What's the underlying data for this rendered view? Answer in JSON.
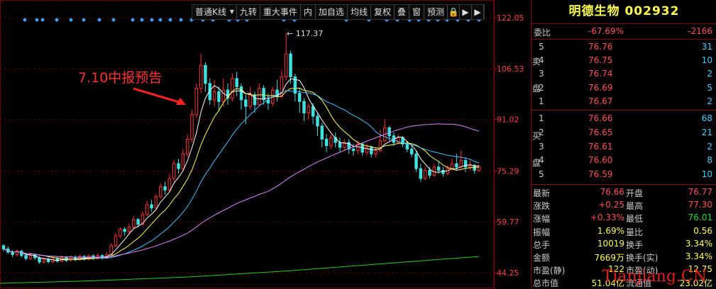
{
  "toolbar": {
    "items": [
      "普通K线",
      "九转",
      "重大事件",
      "内",
      "加自选",
      "均线",
      "复权",
      "叠",
      "窗",
      "预测"
    ],
    "nav_lock": "🔒",
    "nav_right": "▶",
    "nav_right2": "▶"
  },
  "annotation": {
    "text": "7.10中报预告",
    "peak_label": "117.37"
  },
  "price_axis": [
    "122.05",
    "106.53",
    "91.02",
    "75.29",
    "59.77",
    "44.25"
  ],
  "colors": {
    "up": "#ff3030",
    "down": "#40e0e0",
    "ma5": "#ffffff",
    "ma10": "#ffff50",
    "ma20": "#40c0ff",
    "ma60": "#e080ff",
    "ma250": "#20d020",
    "grid": "#700000"
  },
  "chart_data": {
    "type": "candlestick",
    "y_axis_ticks": [
      122.05,
      106.53,
      91.02,
      75.29,
      59.77,
      44.25
    ],
    "ylim": [
      44.25,
      122.05
    ],
    "annotations": [
      {
        "text": "7.10中报预告"
      },
      {
        "text": "117.37"
      }
    ],
    "candles": [
      [
        52.5,
        51.5,
        53.0,
        50.8
      ],
      [
        51.5,
        50.5,
        52.3,
        50.0
      ],
      [
        50.5,
        49.8,
        51.2,
        49.0
      ],
      [
        49.8,
        50.8,
        51.4,
        49.2
      ],
      [
        50.8,
        49.5,
        51.3,
        48.9
      ],
      [
        49.5,
        48.6,
        50.2,
        48.0
      ],
      [
        48.6,
        49.6,
        50.3,
        48.1
      ],
      [
        49.6,
        48.8,
        50.0,
        48.2
      ],
      [
        48.8,
        47.5,
        49.3,
        47.0
      ],
      [
        47.5,
        48.4,
        48.9,
        47.0
      ],
      [
        48.4,
        47.6,
        48.8,
        47.1
      ],
      [
        47.6,
        48.5,
        49.0,
        47.2
      ],
      [
        48.5,
        47.8,
        49.0,
        47.3
      ],
      [
        47.8,
        48.9,
        49.4,
        47.4
      ],
      [
        48.9,
        48.0,
        49.3,
        47.5
      ],
      [
        48.0,
        49.0,
        49.6,
        47.6
      ],
      [
        49.0,
        48.2,
        49.5,
        47.7
      ],
      [
        48.2,
        49.2,
        49.8,
        47.9
      ],
      [
        49.2,
        48.4,
        49.7,
        47.9
      ],
      [
        48.4,
        49.4,
        49.9,
        48.0
      ],
      [
        49.4,
        48.6,
        49.9,
        48.1
      ],
      [
        48.6,
        49.5,
        50.2,
        48.2
      ],
      [
        49.5,
        48.7,
        49.9,
        48.2
      ],
      [
        48.7,
        49.8,
        50.5,
        48.4
      ],
      [
        49.8,
        52.5,
        53.2,
        49.5
      ],
      [
        52.5,
        55.5,
        56.3,
        52.0
      ],
      [
        55.5,
        57.5,
        58.0,
        54.8
      ],
      [
        57.5,
        56.8,
        58.2,
        55.5
      ],
      [
        56.8,
        58.2,
        59.2,
        56.0
      ],
      [
        58.2,
        60.5,
        61.5,
        57.5
      ],
      [
        60.5,
        59.0,
        61.0,
        58.0
      ],
      [
        59.0,
        62.0,
        63.0,
        58.5
      ],
      [
        62.0,
        65.0,
        66.2,
        61.5
      ],
      [
        65.0,
        64.0,
        66.5,
        62.8
      ],
      [
        64.0,
        67.5,
        68.2,
        63.5
      ],
      [
        67.5,
        70.5,
        71.5,
        66.8
      ],
      [
        70.5,
        69.5,
        72.0,
        68.0
      ],
      [
        69.5,
        73.0,
        74.5,
        68.8
      ],
      [
        73.0,
        77.5,
        78.5,
        72.0
      ],
      [
        77.5,
        76.0,
        79.0,
        74.5
      ],
      [
        76.0,
        80.5,
        82.0,
        75.5
      ],
      [
        80.5,
        85.0,
        86.5,
        79.5
      ],
      [
        85.0,
        92.5,
        94.0,
        84.0
      ],
      [
        92.5,
        100.5,
        102.0,
        91.5
      ],
      [
        100.5,
        107.5,
        111.0,
        99.0
      ],
      [
        107.5,
        102.0,
        108.5,
        99.5
      ],
      [
        102.0,
        97.0,
        103.5,
        95.5
      ],
      [
        97.0,
        99.5,
        103.0,
        95.0
      ],
      [
        99.5,
        96.5,
        101.0,
        93.5
      ],
      [
        96.5,
        100.0,
        103.5,
        95.0
      ],
      [
        100.0,
        97.5,
        102.0,
        95.5
      ],
      [
        97.5,
        103.5,
        105.0,
        96.5
      ],
      [
        103.5,
        101.0,
        105.5,
        98.0
      ],
      [
        101.0,
        97.0,
        102.0,
        94.0
      ],
      [
        97.0,
        95.0,
        98.5,
        89.5
      ],
      [
        95.0,
        98.5,
        101.0,
        94.0
      ],
      [
        98.5,
        95.5,
        99.5,
        93.0
      ],
      [
        95.5,
        100.5,
        102.0,
        95.0
      ],
      [
        100.5,
        97.0,
        101.5,
        95.5
      ],
      [
        97.0,
        96.0,
        99.0,
        94.0
      ],
      [
        96.0,
        100.0,
        101.0,
        95.0
      ],
      [
        100.0,
        98.0,
        103.0,
        96.5
      ],
      [
        98.0,
        104.0,
        106.0,
        97.5
      ],
      [
        104.0,
        111.0,
        117.37,
        103.0
      ],
      [
        111.0,
        104.0,
        112.0,
        102.0
      ],
      [
        104.0,
        99.0,
        105.0,
        96.5
      ],
      [
        99.0,
        96.5,
        100.5,
        93.0
      ],
      [
        96.5,
        93.0,
        97.5,
        90.5
      ],
      [
        93.0,
        95.0,
        96.0,
        91.0
      ],
      [
        95.0,
        92.0,
        96.0,
        89.5
      ],
      [
        92.0,
        89.0,
        93.0,
        86.0
      ],
      [
        89.0,
        85.0,
        90.0,
        82.5
      ],
      [
        85.0,
        83.0,
        86.5,
        81.0
      ],
      [
        83.0,
        85.5,
        86.5,
        82.0
      ],
      [
        85.5,
        84.0,
        87.0,
        82.5
      ],
      [
        84.0,
        82.5,
        85.5,
        81.0
      ],
      [
        82.5,
        84.0,
        85.0,
        81.5
      ],
      [
        84.0,
        82.0,
        85.0,
        80.5
      ],
      [
        82.0,
        81.5,
        83.5,
        80.0
      ],
      [
        81.5,
        83.5,
        84.5,
        80.5
      ],
      [
        83.5,
        81.0,
        84.0,
        80.0
      ],
      [
        81.0,
        82.5,
        83.5,
        80.0
      ],
      [
        82.5,
        80.5,
        83.0,
        79.5
      ],
      [
        80.5,
        81.5,
        82.5,
        79.5
      ],
      [
        81.5,
        84.5,
        88.0,
        81.0
      ],
      [
        84.5,
        88.5,
        91.0,
        84.0
      ],
      [
        88.5,
        86.0,
        89.0,
        84.5
      ],
      [
        86.0,
        84.0,
        87.0,
        83.0
      ],
      [
        84.0,
        85.5,
        86.5,
        83.5
      ],
      [
        85.5,
        83.5,
        86.0,
        82.5
      ],
      [
        83.5,
        82.0,
        84.5,
        81.0
      ],
      [
        82.0,
        80.5,
        83.0,
        79.5
      ],
      [
        80.5,
        76.0,
        81.5,
        75.0
      ],
      [
        76.0,
        73.0,
        77.5,
        72.0
      ],
      [
        73.0,
        75.5,
        76.5,
        72.5
      ],
      [
        75.5,
        74.0,
        76.5,
        73.0
      ],
      [
        74.0,
        76.5,
        77.5,
        73.5
      ],
      [
        76.5,
        75.5,
        78.0,
        74.5
      ],
      [
        75.5,
        74.5,
        76.5,
        73.5
      ],
      [
        74.5,
        76.0,
        77.0,
        74.0
      ],
      [
        76.0,
        77.5,
        79.0,
        75.5
      ],
      [
        77.5,
        76.5,
        80.5,
        75.5
      ],
      [
        76.5,
        78.5,
        81.5,
        76.0
      ],
      [
        78.5,
        76.5,
        79.5,
        75.0
      ],
      [
        76.5,
        77.0,
        78.5,
        75.5
      ],
      [
        77.0,
        75.5,
        77.5,
        74.5
      ],
      [
        75.5,
        76.66,
        77.3,
        75.0
      ]
    ],
    "ma250": [
      [
        0,
        41.0
      ],
      [
        0.2,
        41.8
      ],
      [
        0.4,
        43.0
      ],
      [
        0.6,
        44.8
      ],
      [
        0.8,
        47.0
      ],
      [
        1.0,
        49.2
      ]
    ]
  },
  "panel": {
    "title": "明德生物 002932",
    "weibi": {
      "label": "委比",
      "pct": "-67.69%",
      "num": "-2166"
    },
    "sell_label": [
      "卖",
      "盘"
    ],
    "buy_label": [
      "买",
      "盘"
    ],
    "sell": [
      {
        "lvl": "5",
        "price": "76.76",
        "vol": "31"
      },
      {
        "lvl": "4",
        "price": "76.75",
        "vol": "10"
      },
      {
        "lvl": "3",
        "price": "76.74",
        "vol": "2"
      },
      {
        "lvl": "2",
        "price": "76.69",
        "vol": "5"
      },
      {
        "lvl": "1",
        "price": "76.67",
        "vol": "2"
      }
    ],
    "buy": [
      {
        "lvl": "1",
        "price": "76.66",
        "vol": "68"
      },
      {
        "lvl": "2",
        "price": "76.65",
        "vol": "21"
      },
      {
        "lvl": "3",
        "price": "76.61",
        "vol": "2"
      },
      {
        "lvl": "4",
        "price": "76.60",
        "vol": "8"
      },
      {
        "lvl": "5",
        "price": "76.59",
        "vol": "10"
      }
    ],
    "stats": [
      {
        "l1": "最新",
        "v1": "76.66",
        "c1": "red",
        "l2": "开盘",
        "v2": "76.77",
        "c2": "red"
      },
      {
        "l1": "涨跌",
        "v1": "+0.25",
        "c1": "red",
        "l2": "最高",
        "v2": "77.30",
        "c2": "red"
      },
      {
        "l1": "涨幅",
        "v1": "+0.33%",
        "c1": "red",
        "l2": "最低",
        "v2": "76.01",
        "c2": "grn"
      },
      {
        "l1": "振幅",
        "v1": "1.69%",
        "c1": "ylw",
        "l2": "量比",
        "v2": "0.56",
        "c2": "ylw"
      },
      {
        "l1": "总手",
        "v1": "10019",
        "c1": "ylw",
        "l2": "换手",
        "v2": "3.34%",
        "c2": "ylw"
      },
      {
        "l1": "金额",
        "v1": "7669万",
        "c1": "ylw",
        "l2": "换手(实)",
        "v2": "3.34%",
        "c2": "ylw"
      },
      {
        "l1": "市盈(静)",
        "v1": "122",
        "c1": "ylw",
        "l2": "市盈(动)",
        "v2": "12.75",
        "c2": "ylw"
      },
      {
        "l1": "总市值",
        "v1": "51.04亿",
        "c1": "ylw",
        "l2": "流通值",
        "v2": "23.02亿",
        "c2": "ylw"
      }
    ],
    "watermark": "Tianjiang.CN"
  }
}
